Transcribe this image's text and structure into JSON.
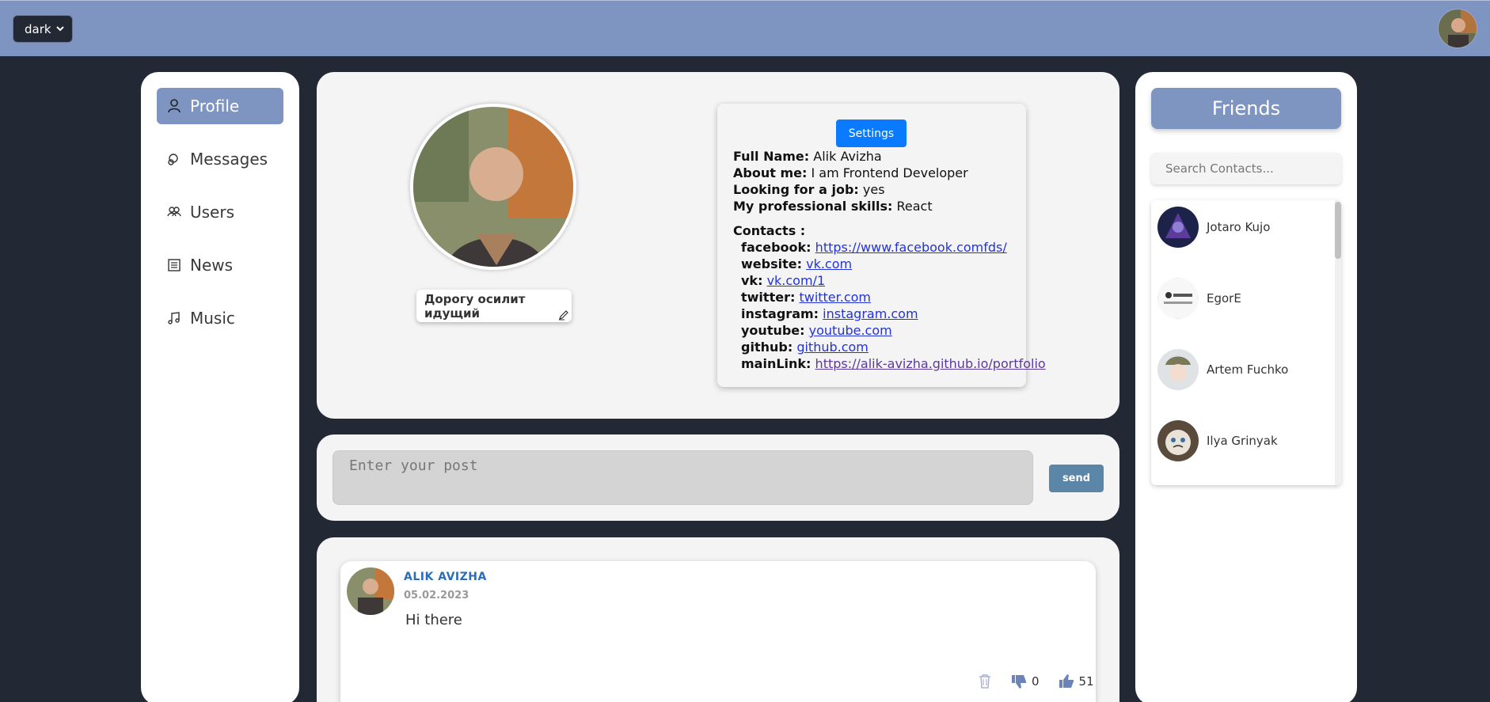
{
  "header": {
    "theme_value": "dark",
    "theme_options": [
      "dark"
    ]
  },
  "nav": {
    "items": [
      {
        "label": "Profile",
        "icon": "user-icon",
        "active": true
      },
      {
        "label": "Messages",
        "icon": "chat-bubbles-icon"
      },
      {
        "label": "Users",
        "icon": "users-icon"
      },
      {
        "label": "News",
        "icon": "newspaper-icon"
      },
      {
        "label": "Music",
        "icon": "music-note-icon"
      }
    ]
  },
  "profile": {
    "status": "Дорогу осилит идущий",
    "settings_label": "Settings",
    "fields": {
      "full_name_label": "Full Name:",
      "full_name": "Alik Avizha",
      "about_label": "About me:",
      "about": "I am Frontend Developer",
      "job_label": "Looking for a job:",
      "job": "yes",
      "skills_label": "My professional skills:",
      "skills": "React"
    },
    "contacts_label": "Contacts :",
    "contacts": [
      {
        "label": "facebook:",
        "value": "https://www.facebook.comfds/"
      },
      {
        "label": "website:",
        "value": "vk.com"
      },
      {
        "label": "vk:",
        "value": "vk.com/1"
      },
      {
        "label": "twitter:",
        "value": "twitter.com"
      },
      {
        "label": "instagram:",
        "value": "instagram.com"
      },
      {
        "label": "youtube:",
        "value": "youtube.com"
      },
      {
        "label": "github:",
        "value": "github.com"
      },
      {
        "label": "mainLink:",
        "value": "https://alik-avizha.github.io/portfolio"
      }
    ]
  },
  "composer": {
    "placeholder": "Enter your post",
    "send_label": "send"
  },
  "posts": [
    {
      "author": "ALIK AVIZHA",
      "date": "05.02.2023",
      "text": "Hi there",
      "dislikes": "0",
      "likes": "51"
    }
  ],
  "friends": {
    "title": "Friends",
    "search_placeholder": "Search Contacts...",
    "items": [
      {
        "name": "Jotaro Kujo"
      },
      {
        "name": "EgorE"
      },
      {
        "name": "Artem Fuchko"
      },
      {
        "name": "Ilya Grinyak"
      }
    ]
  },
  "colors": {
    "accent": "#7f95c1",
    "background": "#222834",
    "settings_button": "#0a7bff",
    "send_button": "#5b86a8",
    "author": "#2c6cb8"
  }
}
